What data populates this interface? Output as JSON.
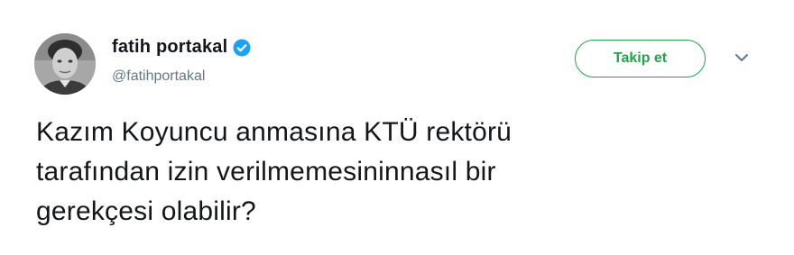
{
  "author": {
    "display_name": "fatih portakal",
    "handle": "@fatihportakal",
    "verified": true,
    "avatar_icon": "user-photo-avatar"
  },
  "actions": {
    "follow_label": "Takip et",
    "more_icon": "chevron-down-icon"
  },
  "tweet": {
    "text": "Kazım Koyuncu anmasına KTÜ rektörü\ntarafından izin verilmemesininnasıl bir\ngerekçesi olabilir?"
  },
  "colors": {
    "follow_accent": "#22a34a",
    "verified_blue": "#1da1f2",
    "handle_gray": "#657786",
    "text": "#14171a"
  }
}
